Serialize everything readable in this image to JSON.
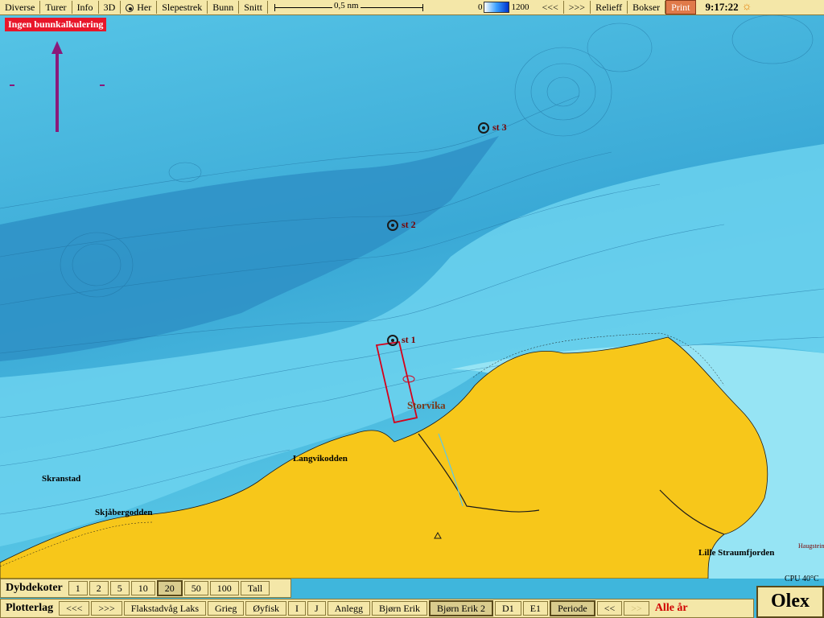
{
  "topbar": {
    "menu": [
      "Diverse",
      "Turer",
      "Info",
      "3D"
    ],
    "here_label": "Her",
    "tools": [
      "Slepestrek",
      "Bunn",
      "Snitt"
    ],
    "scale_label": "0,5 nm",
    "depth_min": "0",
    "depth_max": "1200",
    "nav_prev": "<<<",
    "nav_next": ">>>",
    "relief": "Relieff",
    "boxes": "Bokser",
    "print": "Print",
    "time": "9:17:22"
  },
  "alert": "Ingen bunnkalkulering",
  "map": {
    "stations": [
      "st 3",
      "st 2",
      "st 1"
    ],
    "place_storvika": "Storvika",
    "places": [
      "Langvikodden",
      "Skranstad",
      "Skjåbergodden",
      "Lille Straumfjorden"
    ],
    "cpu": "CPU 40°C",
    "haugsteinen": "Haugstein"
  },
  "depth_contours": {
    "label": "Dybdekoter",
    "options": [
      "1",
      "2",
      "5",
      "10",
      "20",
      "50",
      "100",
      "Tall"
    ],
    "selected": "20"
  },
  "plotter": {
    "label": "Plotterlag",
    "prev": "<<<",
    "next": ">>>",
    "layers": [
      "Flakstadvåg Laks",
      "Grieg",
      "Øyfisk",
      "I",
      "J",
      "Anlegg",
      "Bjørn Erik",
      "Bjørn Erik 2",
      "D1",
      "E1",
      "Periode",
      "<<",
      ">>"
    ],
    "active_layer": "Bjørn Erik 2",
    "all_years": "Alle år"
  },
  "brand": "Olex",
  "colors": {
    "land": "#f7c71a",
    "water_deep": "#3fb0d8",
    "water_shallow": "#8fe1f2",
    "alert": "#e8162a"
  }
}
